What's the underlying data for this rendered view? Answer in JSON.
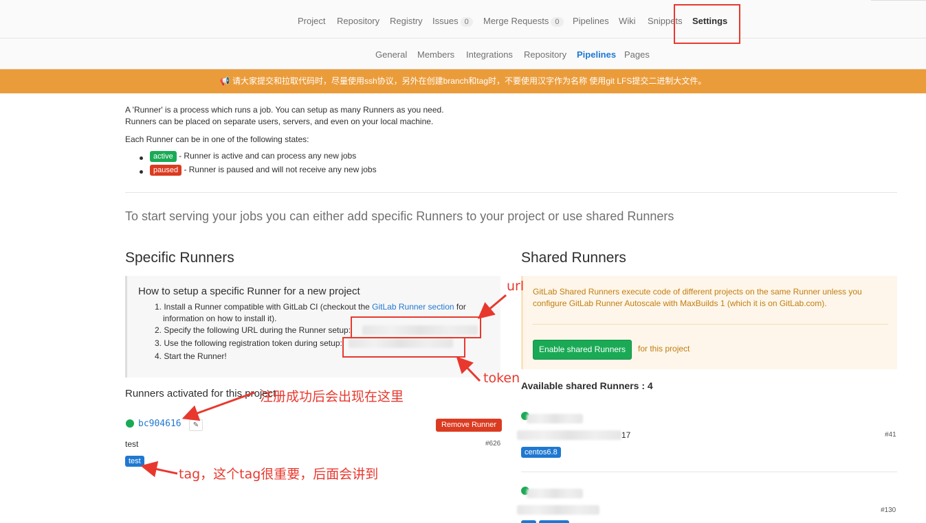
{
  "topnav": {
    "items": [
      {
        "label": "Project"
      },
      {
        "label": "Repository"
      },
      {
        "label": "Registry"
      },
      {
        "label": "Issues",
        "badge": "0"
      },
      {
        "label": "Merge Requests",
        "badge": "0"
      },
      {
        "label": "Pipelines"
      },
      {
        "label": "Wiki"
      },
      {
        "label": "Snippets"
      },
      {
        "label": "Settings"
      }
    ]
  },
  "subnav": {
    "items": [
      {
        "label": "General"
      },
      {
        "label": "Members"
      },
      {
        "label": "Integrations"
      },
      {
        "label": "Repository"
      },
      {
        "label": "Pipelines"
      },
      {
        "label": "Pages"
      }
    ]
  },
  "banner": {
    "text": "请大家提交和拉取代码时，尽量使用ssh协议，另外在创建branch和tag时，不要使用汉字作为名称 使用git LFS提交二进制大文件。"
  },
  "intro": {
    "line1": "A 'Runner' is a process which runs a job. You can setup as many Runners as you need.",
    "line2": "Runners can be placed on separate users, servers, and even on your local machine.",
    "line3": "Each Runner can be in one of the following states:",
    "active_badge": "active",
    "active_desc": "- Runner is active and can process any new jobs",
    "paused_badge": "paused",
    "paused_desc": "- Runner is paused and will not receive any new jobs"
  },
  "lead": "To start serving your jobs you can either add specific Runners to your project or use shared Runners",
  "specific": {
    "heading": "Specific Runners",
    "setup_title": "How to setup a specific Runner for a new project",
    "step1_a": "1. Install a Runner compatible with GitLab CI (checkout the ",
    "step1_link": "GitLab Runner section",
    "step1_b": " for",
    "step1_c": "information on how to install it).",
    "step2": "2. Specify the following URL during the Runner setup:",
    "step3": "3. Use the following registration token during setup:",
    "step4": "4. Start the Runner!",
    "activated_heading": "Runners activated for this project",
    "runner": {
      "id": "bc904616",
      "remove_label": "Remove Runner",
      "description": "test",
      "number": "#626",
      "tag": "test"
    }
  },
  "shared": {
    "heading": "Shared Runners",
    "info": "GitLab Shared Runners execute code of different projects on the same Runner unless you configure GitLab Runner Autoscale with MaxBuilds 1 (which it is on GitLab.com).",
    "enable_label": "Enable shared Runners",
    "for_project": "for this project",
    "available": "Available shared Runners : 4",
    "runners": [
      {
        "tail": "17",
        "number": "#41",
        "tag": "centos6.8"
      },
      {
        "tail": "",
        "number": "#130",
        "tag": ""
      }
    ]
  },
  "annotations": {
    "url": "url",
    "token": "token",
    "registered": "注册成功后会出现在这里",
    "tag_note": "tag，这个tag很重要，后面会讲到"
  },
  "colors": {
    "accent_blue": "#1f78d1",
    "banner_orange": "#eb9c3a",
    "success_green": "#1aaa55",
    "danger_red": "#db3b21",
    "annotation_red": "#e8382e"
  }
}
